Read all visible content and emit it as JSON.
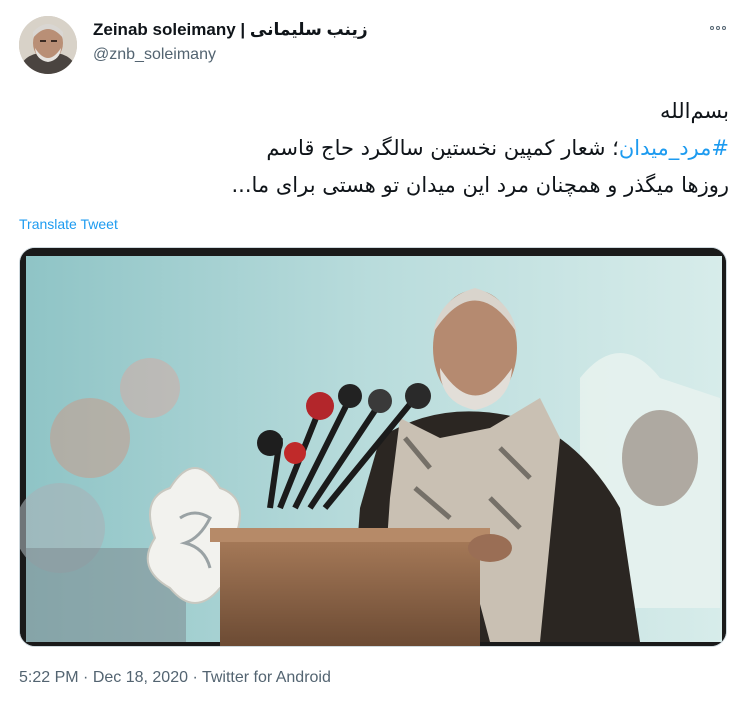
{
  "user": {
    "display_name": "Zeinab soleimany | زینب سلیمانی",
    "handle": "@znb_soleimany"
  },
  "tweet": {
    "line1": "بسم‌الله",
    "hashtag": "#مرد_میدان",
    "line2_rest": "؛ شعار کمپین نخستین سالگرد حاج قاسم",
    "line3": "روزها میگذر و همچنان مرد این میدان تو هستی برای ما..."
  },
  "translate_label": "Translate Tweet",
  "footer": {
    "time": "5:22 PM",
    "sep1": " · ",
    "date": "Dec 18, 2020",
    "sep2": " · ",
    "source": "Twitter for Android"
  },
  "colors": {
    "link": "#1d9bf0",
    "secondary_text": "#536471"
  },
  "icons": [
    "more-options-icon"
  ]
}
